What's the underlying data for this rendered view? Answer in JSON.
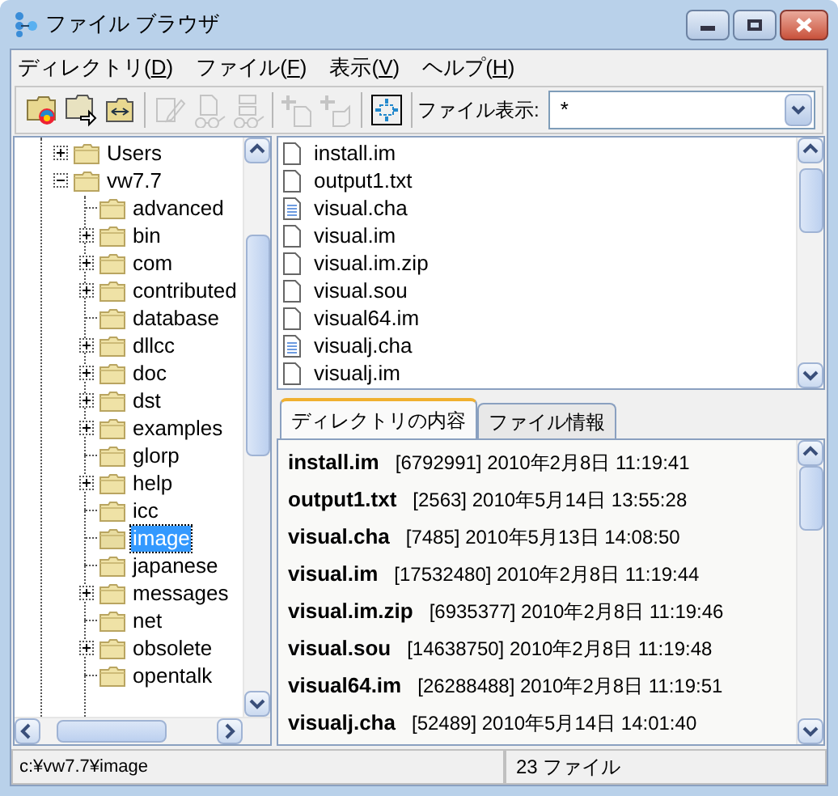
{
  "window": {
    "title": "ファイル ブラウザ"
  },
  "menu": [
    {
      "prefix": "ディレクトリ(",
      "key": "D",
      "suffix": ")"
    },
    {
      "prefix": "ファイル(",
      "key": "F",
      "suffix": ")"
    },
    {
      "prefix": "表示(",
      "key": "V",
      "suffix": ")"
    },
    {
      "prefix": "ヘルプ(",
      "key": "H",
      "suffix": ")"
    }
  ],
  "toolbar": {
    "groups": [
      [
        {
          "kind": "folder-color",
          "disabled": false
        },
        {
          "kind": "folder-arrow",
          "disabled": false
        },
        {
          "kind": "folder-swap",
          "disabled": false
        }
      ],
      [
        {
          "kind": "pencil",
          "disabled": true
        },
        {
          "kind": "doc-glasses",
          "disabled": true
        },
        {
          "kind": "list-glasses",
          "disabled": true
        }
      ],
      [
        {
          "kind": "add-doc",
          "disabled": true
        },
        {
          "kind": "add-box",
          "disabled": true
        }
      ],
      [
        {
          "kind": "fit",
          "disabled": false
        }
      ]
    ],
    "filter_label": "ファイル表示:",
    "filter_value": "*"
  },
  "tree": [
    {
      "label": "Users",
      "expanded": false,
      "selected": false
    },
    {
      "label": "vw7.7",
      "expanded": true,
      "selected": false,
      "children": [
        {
          "label": "advanced",
          "selected": false
        },
        {
          "label": "bin",
          "expanded": false,
          "selected": false
        },
        {
          "label": "com",
          "expanded": false,
          "selected": false
        },
        {
          "label": "contributed",
          "expanded": false,
          "selected": false
        },
        {
          "label": "database",
          "selected": false
        },
        {
          "label": "dllcc",
          "expanded": false,
          "selected": false
        },
        {
          "label": "doc",
          "expanded": false,
          "selected": false
        },
        {
          "label": "dst",
          "expanded": false,
          "selected": false
        },
        {
          "label": "examples",
          "expanded": false,
          "selected": false
        },
        {
          "label": "glorp",
          "selected": false
        },
        {
          "label": "help",
          "expanded": false,
          "selected": false
        },
        {
          "label": "icc",
          "selected": false
        },
        {
          "label": "image",
          "selected": true
        },
        {
          "label": "japanese",
          "selected": false
        },
        {
          "label": "messages",
          "expanded": false,
          "selected": false
        },
        {
          "label": "net",
          "selected": false
        },
        {
          "label": "obsolete",
          "expanded": false,
          "selected": false
        },
        {
          "label": "opentalk",
          "selected": false
        }
      ]
    }
  ],
  "files": [
    {
      "name": "install.im",
      "kind": "blank"
    },
    {
      "name": "output1.txt",
      "kind": "blank"
    },
    {
      "name": "visual.cha",
      "kind": "text"
    },
    {
      "name": "visual.im",
      "kind": "blank"
    },
    {
      "name": "visual.im.zip",
      "kind": "blank"
    },
    {
      "name": "visual.sou",
      "kind": "blank"
    },
    {
      "name": "visual64.im",
      "kind": "blank"
    },
    {
      "name": "visualj.cha",
      "kind": "text"
    },
    {
      "name": "visualj.im",
      "kind": "blank"
    }
  ],
  "tabs": [
    {
      "label": "ディレクトリの内容",
      "selected": true
    },
    {
      "label": "ファイル情報",
      "selected": false
    }
  ],
  "details": [
    {
      "name": "install.im",
      "info": "[6792991] 2010年2月8日 11:19:41"
    },
    {
      "name": "output1.txt",
      "info": "[2563] 2010年5月14日 13:55:28"
    },
    {
      "name": "visual.cha",
      "info": "[7485] 2010年5月13日 14:08:50"
    },
    {
      "name": "visual.im",
      "info": "[17532480] 2010年2月8日 11:19:44"
    },
    {
      "name": "visual.im.zip",
      "info": "[6935377] 2010年2月8日 11:19:46"
    },
    {
      "name": "visual.sou",
      "info": "[14638750] 2010年2月8日 11:19:48"
    },
    {
      "name": "visual64.im",
      "info": "[26288488] 2010年2月8日 11:19:51"
    },
    {
      "name": "visualj.cha",
      "info": "[52489] 2010年5月14日 14:01:40"
    }
  ],
  "status_bar": {
    "path": "c:¥vw7.7¥image",
    "count": "23 ファイル"
  }
}
